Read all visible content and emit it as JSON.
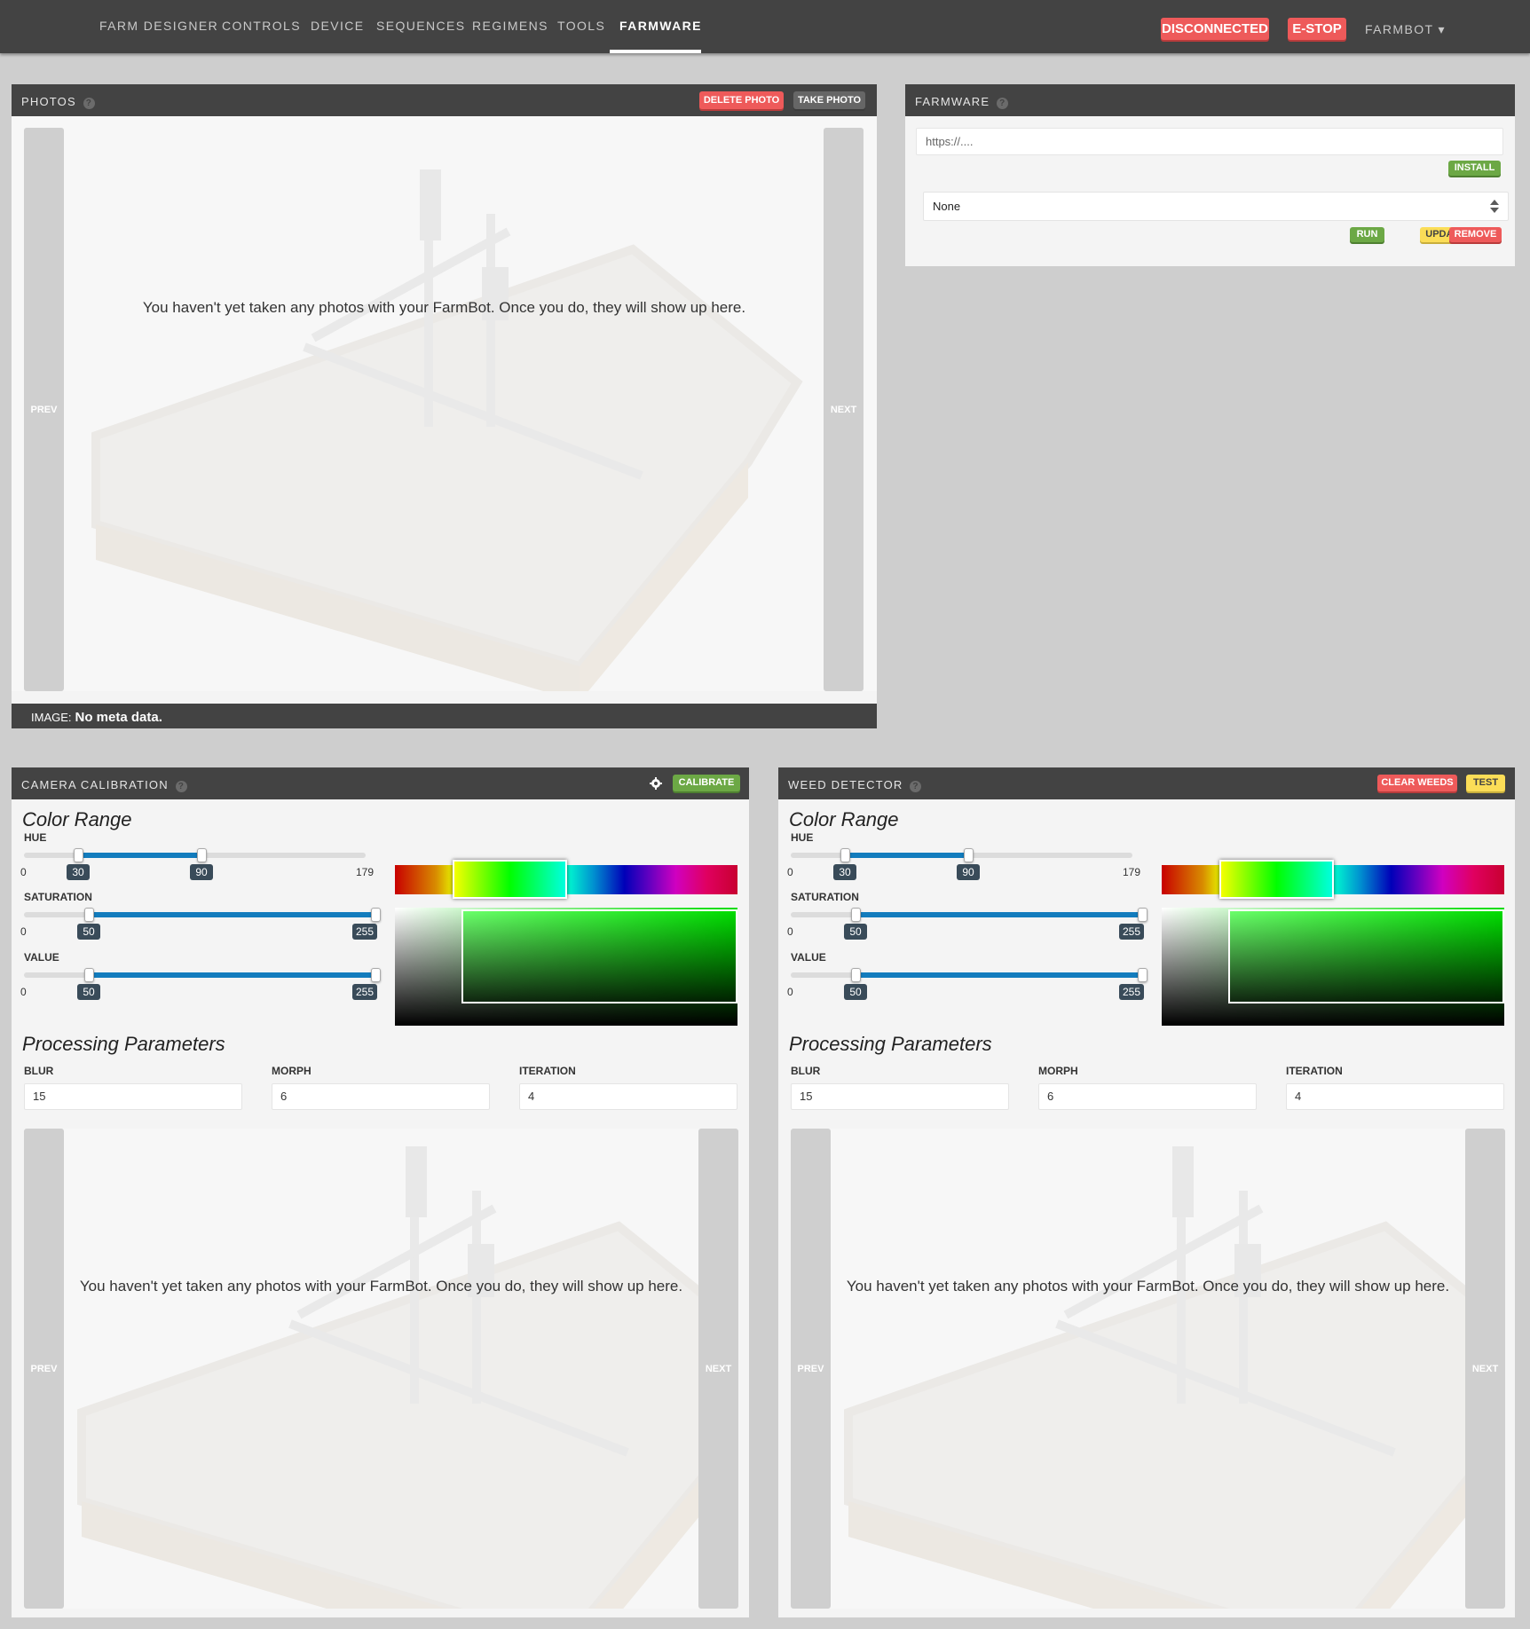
{
  "nav": {
    "links": [
      "FARM DESIGNER",
      "CONTROLS",
      "DEVICE",
      "SEQUENCES",
      "REGIMENS",
      "TOOLS",
      "FARMWARE"
    ],
    "active": "FARMWARE",
    "status_button": "DISCONNECTED",
    "estop_button": "E-STOP",
    "account": "FARMBOT ▾"
  },
  "photos": {
    "title": "PHOTOS",
    "delete_button": "DELETE PHOTO",
    "take_button": "TAKE PHOTO",
    "empty_message": "You haven't yet taken any photos with your FarmBot. Once you do, they will show up here.",
    "prev": "PREV",
    "next": "NEXT",
    "meta_label": "IMAGE:",
    "meta_value": "No meta data."
  },
  "farmware": {
    "title": "FARMWARE",
    "url_placeholder": "https://....",
    "install_button": "INSTALL",
    "selected": "None",
    "run_button": "RUN",
    "update_button": "UPDATE",
    "remove_button": "REMOVE"
  },
  "calibration": {
    "title": "CAMERA CALIBRATION",
    "calibrate_button": "CALIBRATE",
    "color_range": "Color Range",
    "hue": {
      "label": "HUE",
      "min": "0",
      "max": "179",
      "low": "30",
      "high": "90"
    },
    "saturation": {
      "label": "SATURATION",
      "min": "0",
      "low": "50",
      "high": "255"
    },
    "value": {
      "label": "VALUE",
      "min": "0",
      "low": "50",
      "high": "255"
    },
    "processing": "Processing Parameters",
    "blur": {
      "label": "BLUR",
      "value": "15"
    },
    "morph": {
      "label": "MORPH",
      "value": "6"
    },
    "iteration": {
      "label": "ITERATION",
      "value": "4"
    },
    "empty_message": "You haven't yet taken any photos with your FarmBot. Once you do, they will show up here.",
    "prev": "PREV",
    "next": "NEXT"
  },
  "weed": {
    "title": "WEED DETECTOR",
    "clear_button": "CLEAR WEEDS",
    "test_button": "TEST",
    "color_range": "Color Range",
    "hue": {
      "label": "HUE",
      "min": "0",
      "max": "179",
      "low": "30",
      "high": "90"
    },
    "saturation": {
      "label": "SATURATION",
      "min": "0",
      "low": "50",
      "high": "255"
    },
    "value": {
      "label": "VALUE",
      "min": "0",
      "low": "50",
      "high": "255"
    },
    "processing": "Processing Parameters",
    "blur": {
      "label": "BLUR",
      "value": "15"
    },
    "morph": {
      "label": "MORPH",
      "value": "6"
    },
    "iteration": {
      "label": "ITERATION",
      "value": "4"
    },
    "empty_message": "You haven't yet taken any photos with your FarmBot. Once you do, they will show up here.",
    "prev": "PREV",
    "next": "NEXT"
  },
  "colors": {
    "header": "#434343",
    "danger": "#ee5a5a",
    "success": "#6ca845",
    "warning": "#fbdd57",
    "slider": "#137cbd"
  }
}
